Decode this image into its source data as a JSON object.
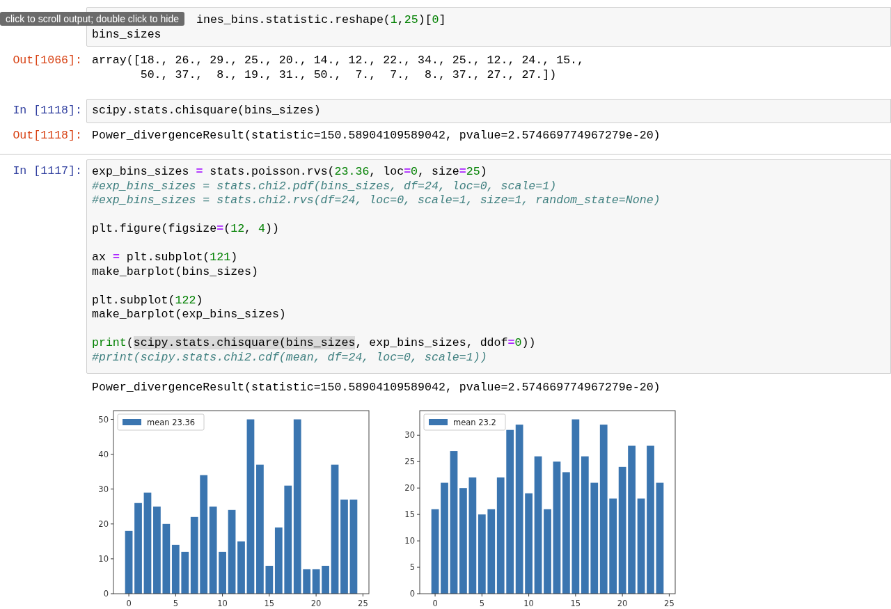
{
  "tooltip": {
    "text": "click to scroll output; double click to hide"
  },
  "cells": [
    {
      "blocks": [
        [
          [
            {
              "text": "ines_bins.statistic.reshape(",
              "kind": "plain"
            },
            {
              "text": "1",
              "kind": "number"
            },
            {
              "text": ",",
              "kind": "plain"
            },
            {
              "text": "25",
              "kind": "number"
            },
            {
              "text": ")[",
              "kind": "plain"
            },
            {
              "text": "0",
              "kind": "number"
            },
            {
              "text": "]",
              "kind": "plain"
            }
          ],
          [
            {
              "text": "bins_sizes",
              "kind": "plain"
            }
          ]
        ]
      ],
      "output": {
        "prompt": "Out[1066]:",
        "lines": [
          "array([18., 26., 29., 25., 20., 14., 12., 22., 34., 25., 12., 24., 15.,",
          "       50., 37.,  8., 19., 31., 50.,  7.,  7.,  8., 37., 27., 27.])"
        ]
      }
    },
    {
      "prompt": "In [1118]:",
      "blocks": [
        [
          [
            {
              "text": "scipy.stats.chisquare(bins_sizes)",
              "kind": "plain"
            }
          ]
        ]
      ],
      "output": {
        "prompt": "Out[1118]:",
        "lines": [
          "Power_divergenceResult(statistic=150.58904109589042, pvalue=2.574669774967279e-20)"
        ]
      }
    },
    {
      "prompt": "In [1117]:",
      "blocks": [
        [
          [
            {
              "text": "exp_bins_sizes ",
              "kind": "plain"
            },
            {
              "text": "=",
              "kind": "operator"
            },
            {
              "text": " stats.poisson.rvs(",
              "kind": "plain"
            },
            {
              "text": "23.36",
              "kind": "number"
            },
            {
              "text": ", loc",
              "kind": "plain"
            },
            {
              "text": "=",
              "kind": "operator"
            },
            {
              "text": "0",
              "kind": "number"
            },
            {
              "text": ", size",
              "kind": "plain"
            },
            {
              "text": "=",
              "kind": "operator"
            },
            {
              "text": "25",
              "kind": "number"
            },
            {
              "text": ")",
              "kind": "plain"
            }
          ],
          [
            {
              "text": "#exp_bins_sizes = stats.chi2.pdf(bins_sizes, df=24, loc=0, scale=1)",
              "kind": "comment"
            }
          ],
          [
            {
              "text": "#exp_bins_sizes = stats.chi2.rvs(df=24, loc=0, scale=1, size=1, random_state=None)",
              "kind": "comment"
            }
          ]
        ],
        [
          [
            {
              "text": "plt.figure(figsize",
              "kind": "plain"
            },
            {
              "text": "=",
              "kind": "operator"
            },
            {
              "text": "(",
              "kind": "plain"
            },
            {
              "text": "12",
              "kind": "number"
            },
            {
              "text": ", ",
              "kind": "plain"
            },
            {
              "text": "4",
              "kind": "number"
            },
            {
              "text": "))",
              "kind": "plain"
            }
          ]
        ],
        [
          [
            {
              "text": "ax ",
              "kind": "plain"
            },
            {
              "text": "=",
              "kind": "operator"
            },
            {
              "text": " plt.subplot(",
              "kind": "plain"
            },
            {
              "text": "121",
              "kind": "number"
            },
            {
              "text": ")",
              "kind": "plain"
            }
          ],
          [
            {
              "text": "make_barplot(bins_sizes)",
              "kind": "plain"
            }
          ]
        ],
        [
          [
            {
              "text": "plt.subplot(",
              "kind": "plain"
            },
            {
              "text": "122",
              "kind": "number"
            },
            {
              "text": ")",
              "kind": "plain"
            }
          ],
          [
            {
              "text": "make_barplot(exp_bins_sizes)",
              "kind": "plain"
            }
          ]
        ],
        [
          [
            {
              "text": "print",
              "kind": "builtin"
            },
            {
              "text": "(",
              "kind": "plain"
            },
            {
              "text": "scipy.stats.chisquare(bins_sizes",
              "kind": "highlight"
            },
            {
              "text": ", exp_bins_sizes, ddof",
              "kind": "plain"
            },
            {
              "text": "=",
              "kind": "operator"
            },
            {
              "text": "0",
              "kind": "number"
            },
            {
              "text": "))",
              "kind": "plain"
            }
          ],
          [
            {
              "text": "#print(scipy.stats.chi2.cdf(mean, df=24, loc=0, scale=1))",
              "kind": "comment"
            }
          ]
        ]
      ],
      "output": {
        "lines": [
          "Power_divergenceResult(statistic=150.58904109589042, pvalue=2.574669774967279e-20)"
        ]
      },
      "charts": [
        {
          "chart_data": {
            "type": "bar",
            "x": [
              0,
              1,
              2,
              3,
              4,
              5,
              6,
              7,
              8,
              9,
              10,
              11,
              12,
              13,
              14,
              15,
              16,
              17,
              18,
              19,
              20,
              21,
              22,
              23,
              24
            ],
            "series": [
              {
                "name": "mean 23.36",
                "color": "#3a75b0",
                "values": [
                  18,
                  26,
                  29,
                  25,
                  20,
                  14,
                  12,
                  22,
                  34,
                  25,
                  12,
                  24,
                  15,
                  50,
                  37,
                  8,
                  19,
                  31,
                  50,
                  7,
                  7,
                  8,
                  37,
                  27,
                  27
                ]
              }
            ],
            "xlim": [
              -1.64,
              25.64
            ],
            "ylim": [
              0,
              52.5
            ],
            "xticks": [
              0,
              5,
              10,
              15,
              20,
              25
            ],
            "yticks": [
              0,
              10,
              20,
              30,
              40,
              50
            ]
          }
        },
        {
          "chart_data": {
            "type": "bar",
            "x": [
              0,
              1,
              2,
              3,
              4,
              5,
              6,
              7,
              8,
              9,
              10,
              11,
              12,
              13,
              14,
              15,
              16,
              17,
              18,
              19,
              20,
              21,
              22,
              23,
              24
            ],
            "series": [
              {
                "name": "mean 23.2",
                "color": "#3a75b0",
                "values": [
                  16,
                  21,
                  27,
                  20,
                  22,
                  15,
                  16,
                  22,
                  31,
                  32,
                  19,
                  26,
                  16,
                  25,
                  23,
                  33,
                  26,
                  21,
                  32,
                  18,
                  24,
                  28,
                  18,
                  28,
                  21
                ]
              }
            ],
            "xlim": [
              -1.64,
              25.64
            ],
            "ylim": [
              0,
              34.65
            ],
            "xticks": [
              0,
              5,
              10,
              15,
              20,
              25
            ],
            "yticks": [
              0,
              5,
              10,
              15,
              20,
              25,
              30
            ]
          }
        }
      ]
    }
  ]
}
